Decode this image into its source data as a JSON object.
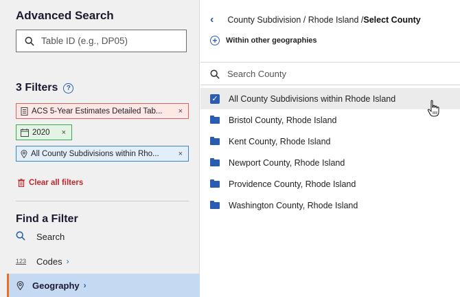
{
  "left": {
    "title": "Advanced Search",
    "table_search": {
      "placeholder": "Table ID (e.g., DP05)",
      "icon": "search-icon"
    },
    "filters_title": "3 Filters",
    "help_icon": "?",
    "chips": [
      {
        "label": "ACS 5-Year Estimates Detailed Tab...",
        "icon": "document-icon",
        "close": "×",
        "color": "#e06060"
      },
      {
        "label": "2020",
        "icon": "calendar-icon",
        "close": "×",
        "color": "#34a853"
      },
      {
        "label": "All County Subdivisions within Rho...",
        "icon": "location-pin-icon",
        "close": "×",
        "color": "#3b82c4"
      }
    ],
    "clear_all": "Clear all filters",
    "find_title": "Find a Filter",
    "nav": [
      {
        "label": "Search",
        "icon": "search-icon"
      },
      {
        "label": "Codes",
        "icon": "123",
        "chevron": "›"
      },
      {
        "label": "Geography",
        "icon": "location-pin-icon",
        "chevron": "›"
      }
    ]
  },
  "right": {
    "breadcrumb": {
      "back": "‹",
      "path": "County Subdivision / Rhode Island / ",
      "current": "Select County"
    },
    "within": {
      "icon": "+",
      "label": "Within other geographies"
    },
    "county_search": {
      "placeholder": "Search County",
      "icon": "search-icon"
    },
    "items": [
      {
        "label": "All County Subdivisions within Rhode Island",
        "type": "checkbox",
        "checked": true
      },
      {
        "label": "Bristol County, Rhode Island",
        "type": "folder"
      },
      {
        "label": "Kent County, Rhode Island",
        "type": "folder"
      },
      {
        "label": "Newport County, Rhode Island",
        "type": "folder"
      },
      {
        "label": "Providence County, Rhode Island",
        "type": "folder"
      },
      {
        "label": "Washington County, Rhode Island",
        "type": "folder"
      }
    ]
  },
  "colors": {
    "accent": "#2a5db0",
    "clear": "#c2272d",
    "active_nav": "#c5d9f2",
    "active_marker": "#e37222"
  }
}
